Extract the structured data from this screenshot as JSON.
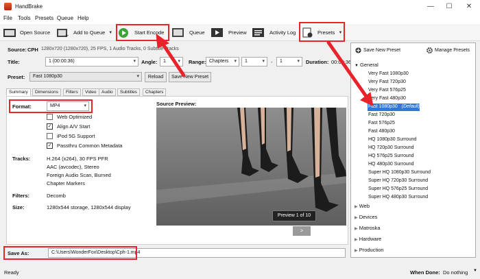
{
  "window": {
    "title": "HandBrake",
    "min": "—",
    "max": "☐",
    "close": "✕"
  },
  "menu": [
    "File",
    "Tools",
    "Presets",
    "Queue",
    "Help"
  ],
  "toolbar": {
    "open_source": "Open Source",
    "add_to_queue": "Add to Queue",
    "start_encode": "Start Encode",
    "queue": "Queue",
    "preview": "Preview",
    "activity_log": "Activity Log",
    "presets": "Presets"
  },
  "source": {
    "label": "Source:",
    "name": "CPH",
    "info": "1280x720 (1280x720), 25 FPS, 1 Audio Tracks, 0 Subtitle Tracks"
  },
  "title_row": {
    "title_label": "Title:",
    "title_value": "1 (00:00:36)",
    "angle_label": "Angle:",
    "angle_value": "1",
    "range_label": "Range:",
    "range_value": "Chapters",
    "range_start": "1",
    "range_sep": "-",
    "range_end": "1",
    "duration_label": "Duration:",
    "duration_value": "00:00:36"
  },
  "preset_row": {
    "label": "Preset:",
    "value": "Fast 1080p30",
    "reload": "Reload",
    "save_new": "Save New Preset"
  },
  "tabs": [
    "Summary",
    "Dimensions",
    "Filters",
    "Video",
    "Audio",
    "Subtitles",
    "Chapters"
  ],
  "summary": {
    "format_label": "Format:",
    "format_value": "MP4",
    "options": [
      {
        "label": "Web Optimized",
        "checked": false
      },
      {
        "label": "Align A/V Start",
        "checked": true
      },
      {
        "label": "iPod 5G Support",
        "checked": false
      },
      {
        "label": "Passthru Common Metadata",
        "checked": true
      }
    ],
    "tracks_label": "Tracks:",
    "tracks": [
      "H.264 (x264), 30 FPS PFR",
      "AAC (avcodec), Stereo",
      "Foreign Audio Scan, Burned",
      "Chapter Markers"
    ],
    "filters_label": "Filters:",
    "filters_value": "Decomb",
    "size_label": "Size:",
    "size_value": "1280x544 storage, 1280x544 display",
    "preview_title": "Source Preview:",
    "preview_badge": "Preview 1 of 10",
    "next_button": ">"
  },
  "save_as": {
    "label": "Save As:",
    "value": "C:\\Users\\WonderFox\\Desktop\\Cph-1.mp4"
  },
  "presets_panel": {
    "save_new": "Save New Preset",
    "manage": "Manage Presets",
    "general_label": "General",
    "general": [
      "Very Fast 1080p30",
      "Very Fast 720p30",
      "Very Fast 576p25",
      "Very Fast 480p30",
      "Fast 1080p30",
      "Fast 720p30",
      "Fast 576p25",
      "Fast 480p30",
      "HQ 1080p30 Surround",
      "HQ 720p30 Surround",
      "HQ 576p25 Surround",
      "HQ 480p30 Surround",
      "Super HQ 1080p30 Surround",
      "Super HQ 720p30 Surround",
      "Super HQ 576p25 Surround",
      "Super HQ 480p30 Surround"
    ],
    "selected_suffix": "(Default)",
    "groups": [
      "Web",
      "Devices",
      "Matroska",
      "Hardware",
      "Production"
    ]
  },
  "status": {
    "left": "Ready",
    "when_done_label": "When Done:",
    "when_done_value": "Do nothing"
  },
  "colors": {
    "accent_red": "#e8232a",
    "selection_blue": "#2f78d7",
    "play_green": "#3fa33a"
  }
}
